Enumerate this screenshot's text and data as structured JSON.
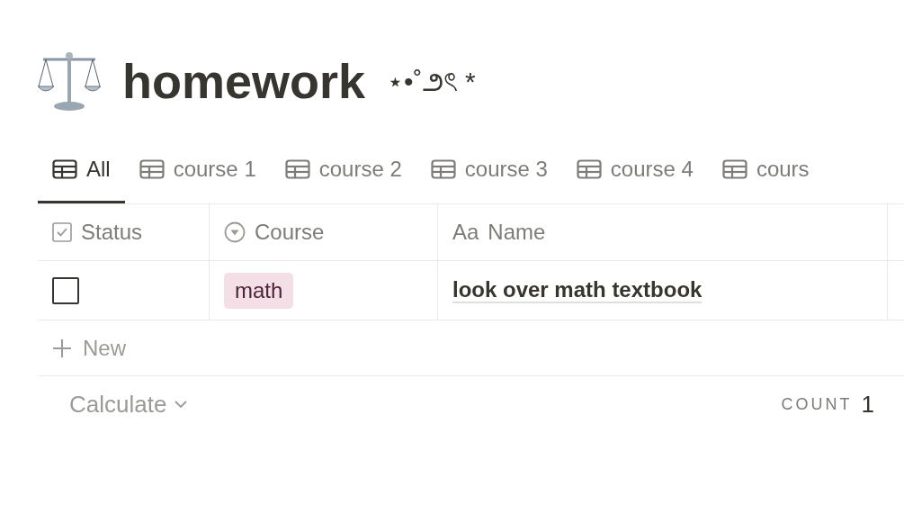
{
  "page": {
    "title": "homework",
    "decoration": "⋆•˚౨ৎ *"
  },
  "tabs": [
    {
      "label": "All",
      "selected": true
    },
    {
      "label": "course 1",
      "selected": false
    },
    {
      "label": "course 2",
      "selected": false
    },
    {
      "label": "course 3",
      "selected": false
    },
    {
      "label": "course 4",
      "selected": false
    },
    {
      "label": "cours",
      "selected": false
    }
  ],
  "table": {
    "columns": [
      {
        "label": "Status",
        "kind": "checkbox"
      },
      {
        "label": "Course",
        "kind": "select"
      },
      {
        "label": "Name",
        "kind": "title",
        "prefix": "Aa"
      }
    ],
    "rows": [
      {
        "checked": false,
        "course": {
          "label": "math",
          "color": "#f4dfe7"
        },
        "name": "look over math textbook"
      }
    ],
    "new_label": "New",
    "calculate": "Calculate",
    "count_label": "COUNT",
    "count": "1"
  }
}
